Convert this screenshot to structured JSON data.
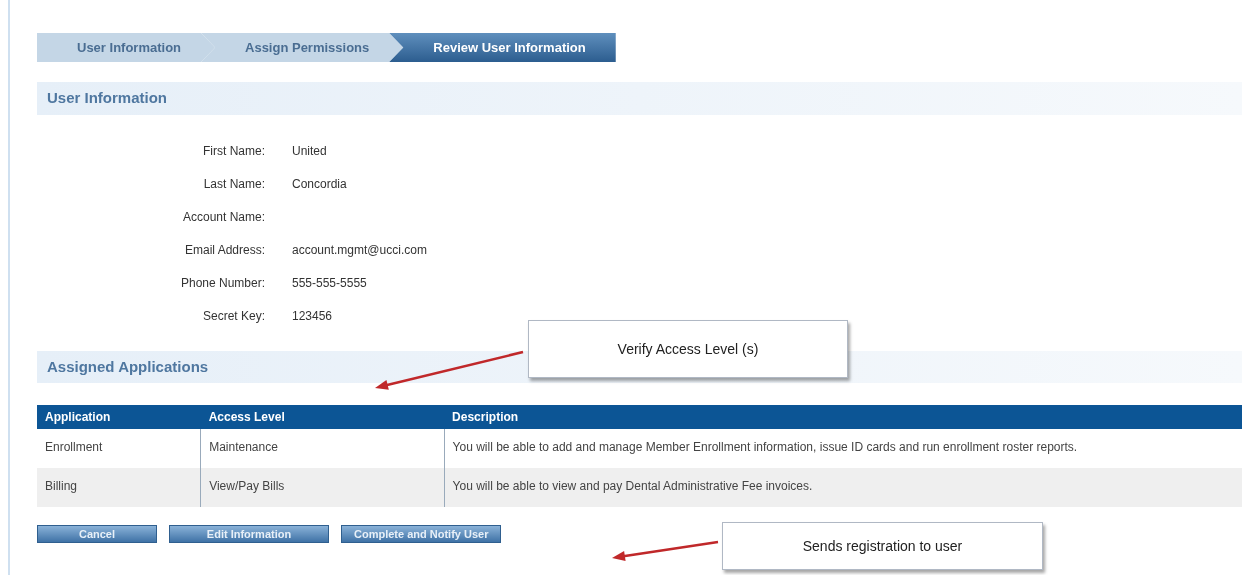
{
  "steps": [
    {
      "label": "User Information",
      "selected": false
    },
    {
      "label": "Assign Permissions",
      "selected": false
    },
    {
      "label": "Review User Information",
      "selected": true
    }
  ],
  "user_information": {
    "title": "User Information",
    "fields": [
      {
        "label": "First Name:",
        "value": "United"
      },
      {
        "label": "Last Name:",
        "value": "Concordia"
      },
      {
        "label": "Account Name:"
      },
      {
        "label": "Email Address:",
        "value": "account.mgmt@ucci.com"
      },
      {
        "label": "Phone Number:",
        "value": "555-555-5555"
      },
      {
        "label": "Secret Key:",
        "value": "123456"
      }
    ]
  },
  "assigned_applications": {
    "title": "Assigned Applications",
    "columns": [
      "Application",
      "Access Level",
      "Description"
    ],
    "rows": [
      {
        "cells": [
          "Enrollment",
          "Maintenance",
          "You will be able to add and manage Member Enrollment information, issue ID cards and run enrollment roster reports."
        ]
      },
      {
        "cells": [
          "Billing",
          "View/Pay Bills",
          "You will be able to view and pay Dental Administrative Fee invoices."
        ]
      }
    ]
  },
  "buttons": [
    "Cancel",
    "Edit Information",
    "Complete and Notify User"
  ],
  "callouts": [
    {
      "text": "Verify Access Level (s)"
    },
    {
      "text": "Sends registration to user"
    }
  ]
}
